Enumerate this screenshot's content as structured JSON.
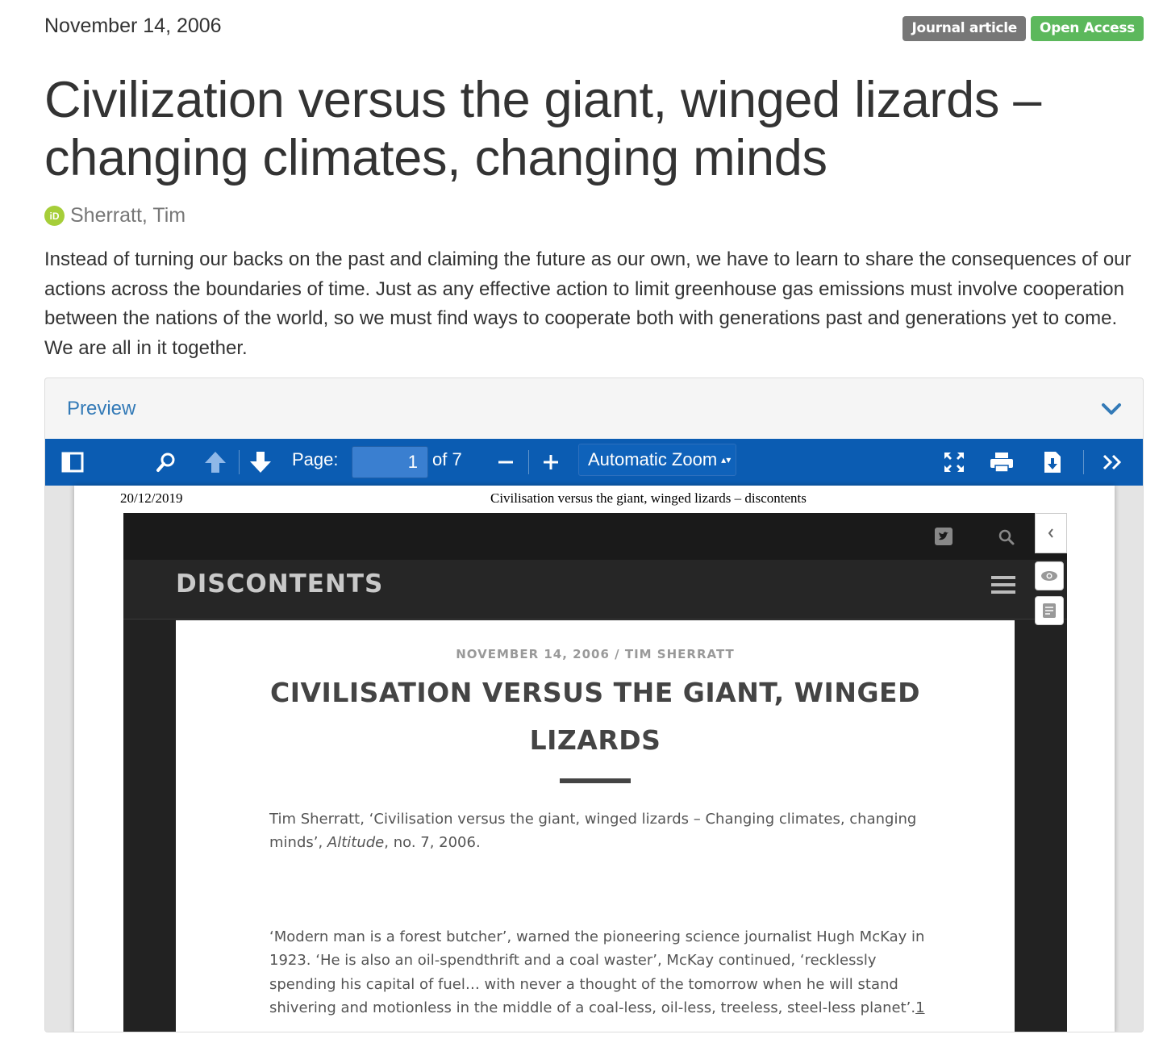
{
  "header": {
    "date": "November 14, 2006",
    "badges": [
      "Journal article",
      "Open Access"
    ]
  },
  "title": "Civilization versus the giant, winged lizards – changing climates, changing minds",
  "author": {
    "name": "Sherratt, Tim",
    "orcid_icon": "iD"
  },
  "abstract": "Instead of turning our backs on the past and claiming the future as our own, we have to learn to share the consequences of our actions across the boundaries of time. Just as any effective action to limit greenhouse gas emissions must involve cooperation between the nations of the world, so we must find ways to cooperate both with generations past and generations yet to come. We are all in it together.",
  "preview": {
    "label": "Preview",
    "toolbar": {
      "page_label": "Page:",
      "page_value": "1",
      "page_of": "of 7",
      "zoom": "Automatic Zoom",
      "zoom_arrows": "▴▾",
      "icons": [
        "sidebar-toggle-icon",
        "search-icon",
        "previous-page-icon",
        "next-page-icon",
        "zoom-out-icon",
        "zoom-in-icon",
        "presentation-mode-icon",
        "print-icon",
        "download-icon",
        "tools-icon"
      ]
    },
    "pdf": {
      "header_date": "20/12/2019",
      "header_title": "Civilisation versus the giant, winged lizards – discontents",
      "site_logo": "DISCONTENTS",
      "meta": "NOVEMBER 14, 2006 / TIM SHERRATT",
      "article_title": "CIVILISATION VERSUS THE GIANT, WINGED LIZARDS",
      "cite_pre": "Tim Sherratt, ‘Civilisation versus the giant, winged lizards – Changing climates, changing minds’, ",
      "cite_italic": "Altitude",
      "cite_post": ", no. 7, 2006.",
      "body": "‘Modern man is a forest butcher’, warned the pioneering science journalist Hugh McKay in 1923. ‘He is also an oil-spendthrift and a coal waster’, McKay continued, ‘recklessly spending his capital of fuel… with never a thought of the tomorrow when he will stand shivering and motionless in the middle of a coal-less, oil-less, treeless, steel-less planet’.",
      "footnote": "1"
    }
  },
  "colors": {
    "toolbar": "#0b5cb2",
    "link": "#337ab7",
    "badge_type": "#777777",
    "badge_open_access": "#5cb85c",
    "orcid": "#a6ce39"
  }
}
